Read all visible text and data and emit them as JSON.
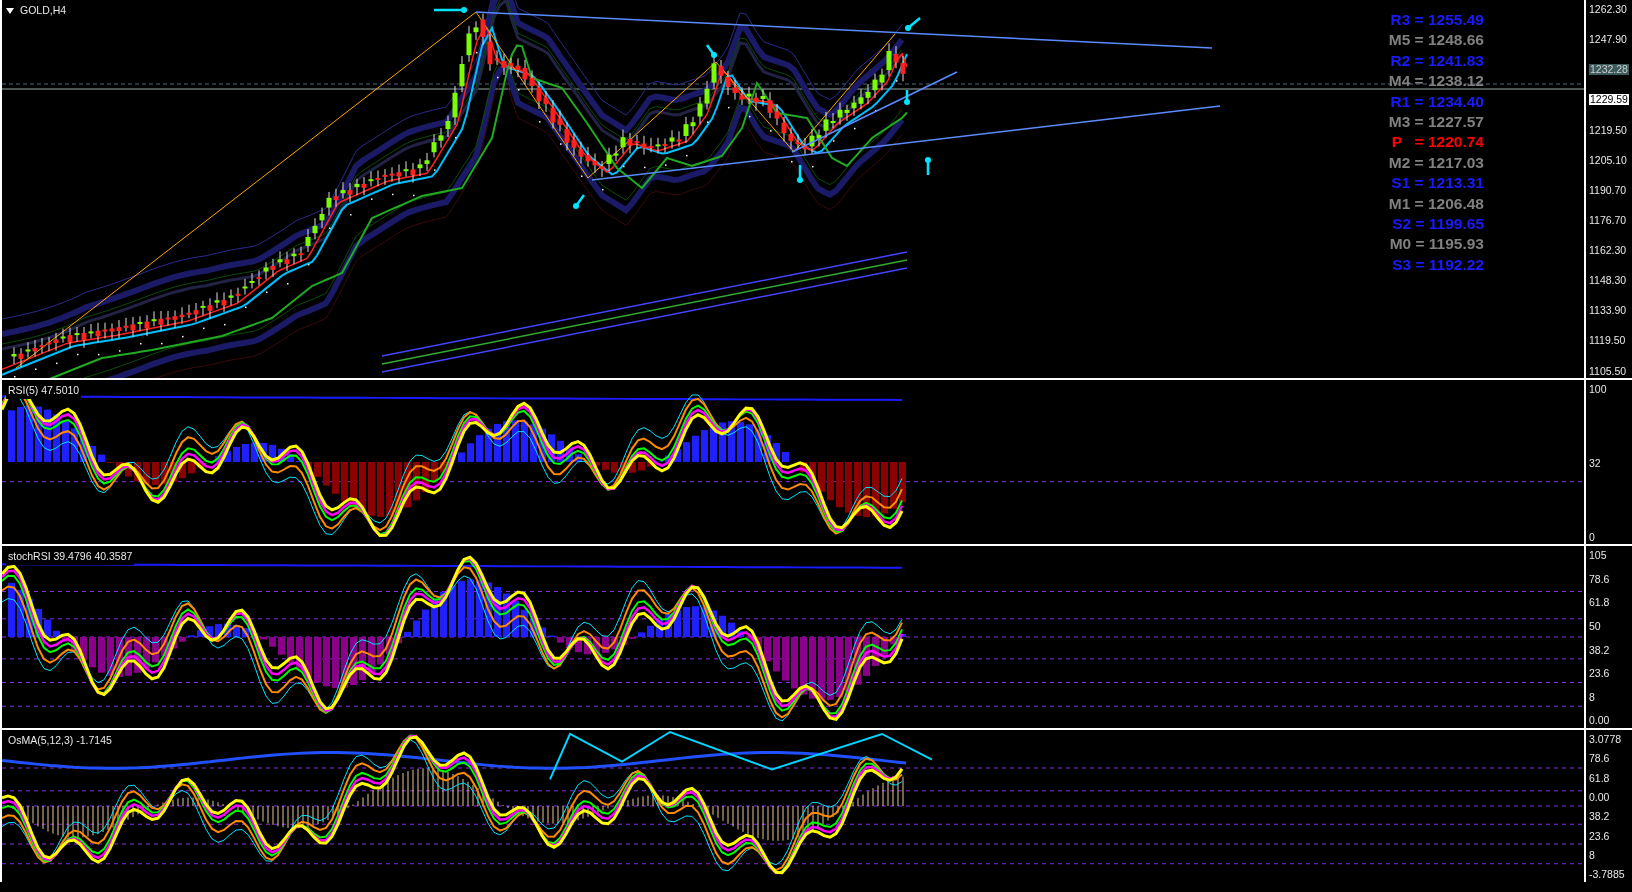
{
  "main_panel": {
    "title": "GOLD,H4",
    "pivot_levels": [
      {
        "label": "R3 = 1255.49",
        "color": "#1a1aff"
      },
      {
        "label": "M5 = 1248.66",
        "color": "#808080"
      },
      {
        "label": "R2 = 1241.83",
        "color": "#1a1aff"
      },
      {
        "label": "M4 = 1238.12",
        "color": "#808080"
      },
      {
        "label": "R1 = 1234.40",
        "color": "#1a1aff"
      },
      {
        "label": "M3 = 1227.57",
        "color": "#808080"
      },
      {
        "label": "P   = 1220.74",
        "color": "#ff0000"
      },
      {
        "label": "M2 = 1217.03",
        "color": "#808080"
      },
      {
        "label": "S1 = 1213.31",
        "color": "#1a1aff"
      },
      {
        "label": "M1 = 1206.48",
        "color": "#808080"
      },
      {
        "label": "S2 = 1199.65",
        "color": "#1a1aff"
      },
      {
        "label": "M0 = 1195.93",
        "color": "#808080"
      },
      {
        "label": "S3 = 1192.22",
        "color": "#1a1aff"
      }
    ],
    "price_axis": [
      {
        "kind": "tick",
        "text": "1262.30"
      },
      {
        "kind": "tick",
        "text": "1247.90"
      },
      {
        "kind": "tag_dark",
        "text": "1232.28"
      },
      {
        "kind": "tag_light",
        "text": "1229.59"
      },
      {
        "kind": "tick",
        "text": "1219.50"
      },
      {
        "kind": "tick",
        "text": "1205.10"
      },
      {
        "kind": "tick",
        "text": "1190.70"
      },
      {
        "kind": "tick",
        "text": "1176.70"
      },
      {
        "kind": "tick",
        "text": "1162.30"
      },
      {
        "kind": "tick",
        "text": "1148.30"
      },
      {
        "kind": "tick",
        "text": "1133.90"
      },
      {
        "kind": "tick",
        "text": "1119.50"
      },
      {
        "kind": "tick",
        "text": "1105.50"
      }
    ]
  },
  "indicator_panels": [
    {
      "kind": "rsi",
      "title": "RSI(5) 47.5010",
      "axis": [
        "100",
        "32",
        "0"
      ]
    },
    {
      "kind": "stoch",
      "title": "stochRSI 39.4796 40.3587",
      "axis": [
        "105",
        "78.6",
        "61.8",
        "50",
        "38.2",
        "23.6",
        "8",
        "0.00"
      ]
    },
    {
      "kind": "osma",
      "title": "OsMA(5,12,3) -1.7145",
      "axis": [
        "3.0778",
        "78.6",
        "61.8",
        "0.00",
        "38.2",
        "23.6",
        "8",
        "-3.7885"
      ]
    }
  ]
}
